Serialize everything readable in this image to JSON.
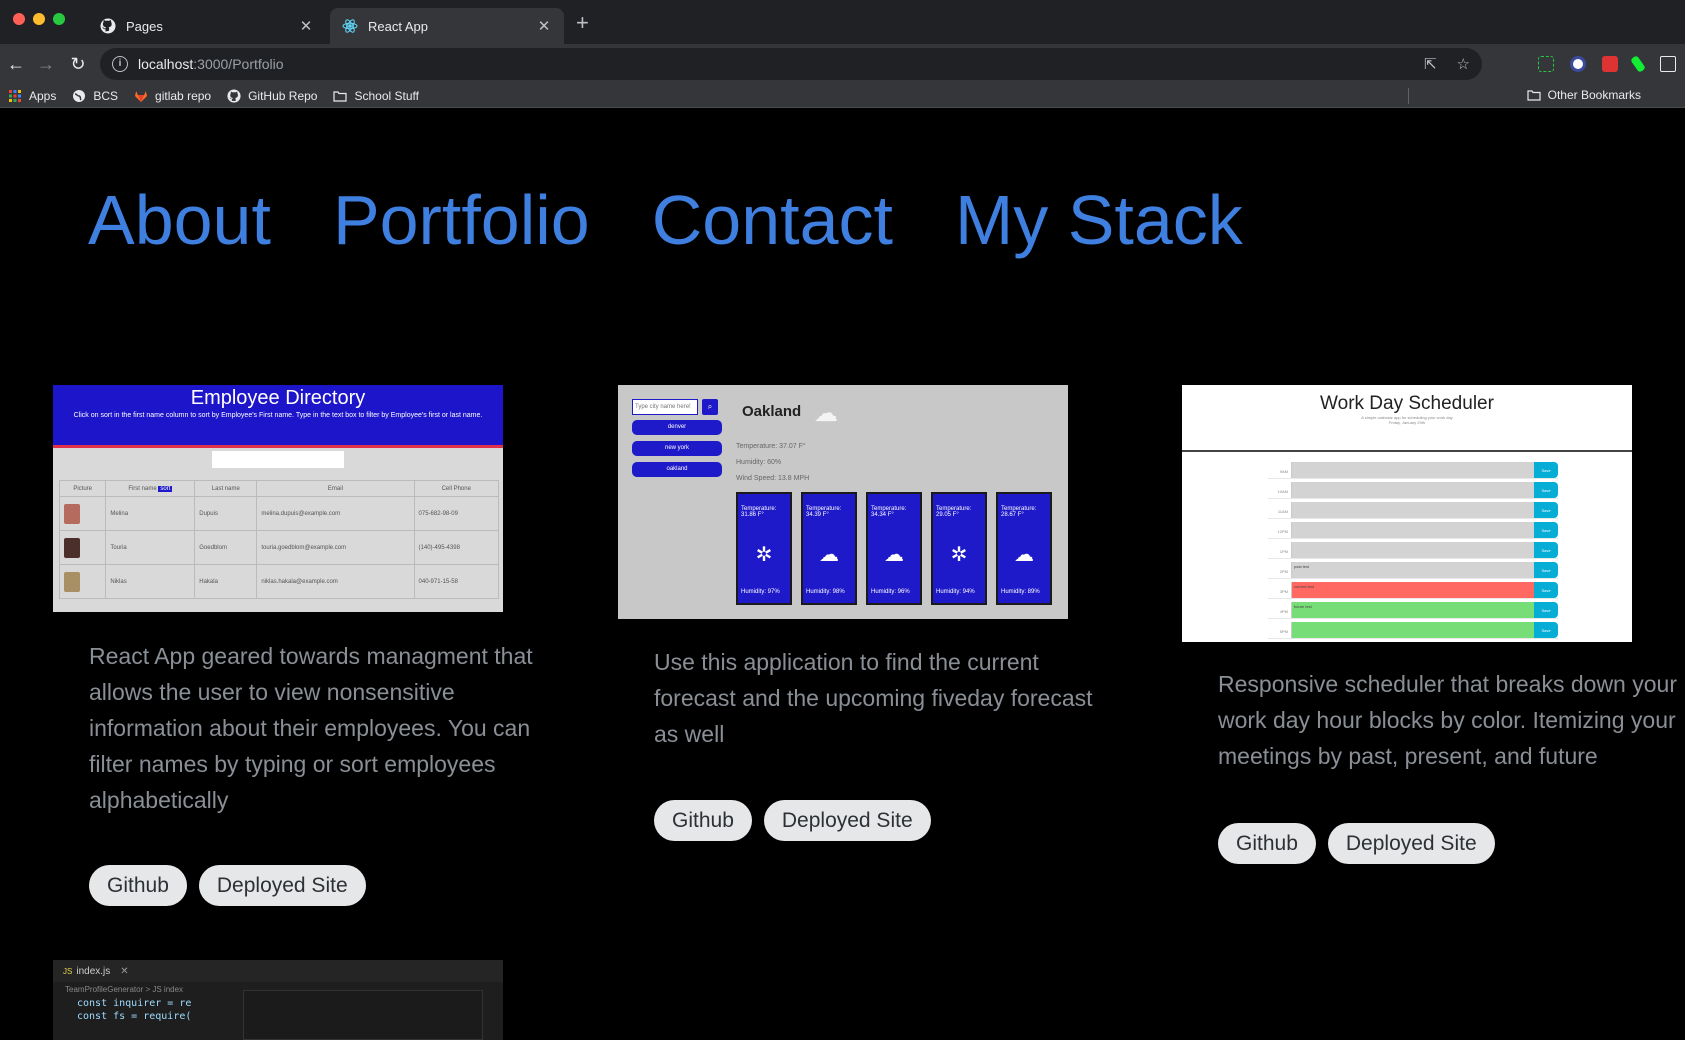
{
  "browser": {
    "tabs": [
      {
        "title": "Pages",
        "icon": "github-icon"
      },
      {
        "title": "React App",
        "icon": "react-icon"
      }
    ],
    "url_host": "localhost",
    "url_path": ":3000/Portfolio",
    "bookmarks": [
      {
        "label": "Apps",
        "icon": "apps-grid-icon"
      },
      {
        "label": "BCS",
        "icon": "globe-icon"
      },
      {
        "label": "gitlab repo",
        "icon": "gitlab-icon"
      },
      {
        "label": "GitHub Repo",
        "icon": "github-icon"
      },
      {
        "label": "School Stuff",
        "icon": "folder-icon"
      }
    ],
    "other_bookmarks": "Other Bookmarks"
  },
  "nav": {
    "about": "About",
    "portfolio": "Portfolio",
    "contact": "Contact",
    "stack": "My Stack"
  },
  "projects": [
    {
      "description": "React App geared towards managment that allows the user to view nonsensitive information about their employees. You can filter names by typing or sort employees alphabetically",
      "github": "Github",
      "deployed": "Deployed Site",
      "screenshot": {
        "title": "Employee Directory",
        "subtitle": "Click on sort in the first name column to sort by Employee's First name. Type in the text box to filter by Employee's first or last name.",
        "columns": [
          "Picture",
          "First name",
          "Last name",
          "Email",
          "Cell Phone"
        ],
        "sort_label": "sort",
        "rows": [
          [
            "Melina",
            "Dupuis",
            "melina.dupuis@example.com",
            "075-682-98-09"
          ],
          [
            "Touria",
            "Goedblom",
            "touria.goedblom@example.com",
            "(140)-495-4398"
          ],
          [
            "Niklas",
            "Hakala",
            "niklas.hakala@example.com",
            "040-971-15-58"
          ]
        ]
      }
    },
    {
      "description": "Use this application to find the current forecast and the upcoming fiveday forecast as well",
      "github": "Github",
      "deployed": "Deployed Site",
      "screenshot": {
        "search_placeholder": "Type city name here!",
        "cities": [
          "denver",
          "new york",
          "oakland"
        ],
        "city": "Oakland",
        "temperature": "Temperature: 37.07 F°",
        "humidity": "Humidity: 60%",
        "wind": "Wind Speed: 13.8 MPH",
        "forecast": [
          {
            "temp": "Temperature: 31.86 F°",
            "humidity": "Humidity: 97%",
            "icon": "snowflake-icon"
          },
          {
            "temp": "Temperature: 34.39 F°",
            "humidity": "Humidity: 98%",
            "icon": "cloud-icon"
          },
          {
            "temp": "Temperature: 34.34 F°",
            "humidity": "Humidity: 96%",
            "icon": "cloud-icon"
          },
          {
            "temp": "Temperature: 29.05 F°",
            "humidity": "Humidity: 94%",
            "icon": "snowflake-icon"
          },
          {
            "temp": "Temperature: 28.67 F°",
            "humidity": "Humidity: 89%",
            "icon": "cloud-icon"
          }
        ]
      }
    },
    {
      "description": "Responsive scheduler that breaks down your work day hour blocks by color. Itemizing your meetings by past, present, and future",
      "github": "Github",
      "deployed": "Deployed Site",
      "screenshot": {
        "title": "Work Day Scheduler",
        "subtitle": "A simple calendar app for scheduling your work day",
        "date": "Friday, January 29th",
        "save_label": "Save",
        "hours": [
          {
            "hour": "9AM",
            "state": "past",
            "text": ""
          },
          {
            "hour": "10AM",
            "state": "past",
            "text": ""
          },
          {
            "hour": "11AM",
            "state": "past",
            "text": ""
          },
          {
            "hour": "12PM",
            "state": "past",
            "text": ""
          },
          {
            "hour": "1PM",
            "state": "past",
            "text": ""
          },
          {
            "hour": "2PM",
            "state": "past",
            "text": "past test"
          },
          {
            "hour": "3PM",
            "state": "present",
            "text": "current test"
          },
          {
            "hour": "4PM",
            "state": "future",
            "text": "future test"
          },
          {
            "hour": "5PM",
            "state": "future",
            "text": ""
          }
        ]
      }
    }
  ],
  "colors": {
    "link": "#3f7fe0",
    "page_bg": "#000000",
    "pill_bg": "#e6e7e9",
    "past": "#d3d3d3",
    "present": "#ff6961",
    "future": "#77dd77"
  },
  "next_project_thumb": {
    "tab": "index.js",
    "breadcrumb": "TeamProfileGenerator > JS index",
    "line1": "const inquirer = re",
    "line2": "const fs = require("
  }
}
